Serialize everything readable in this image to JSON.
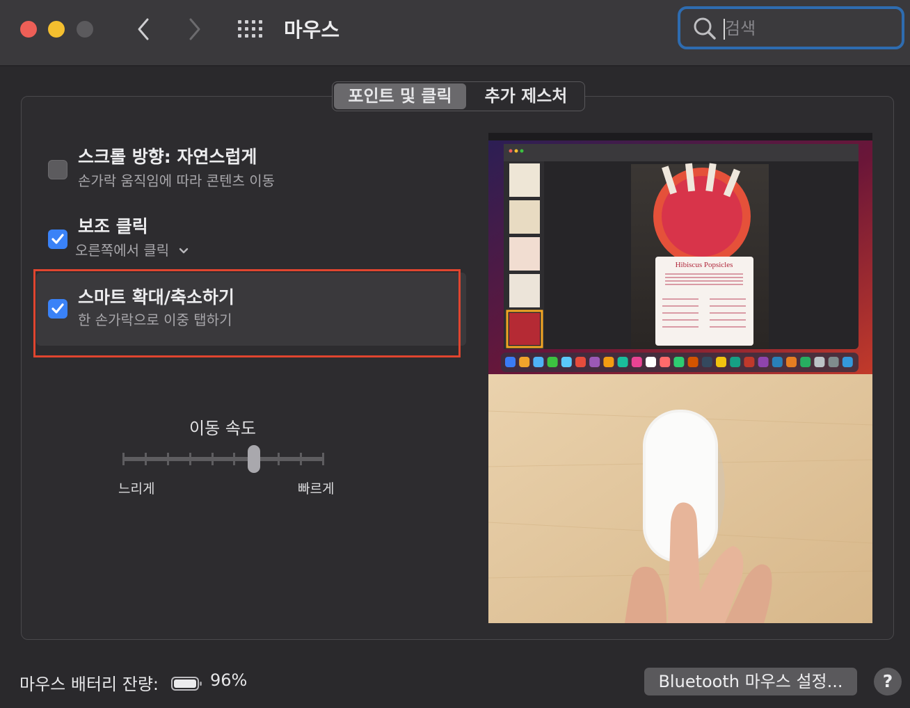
{
  "window": {
    "title": "마우스",
    "search_placeholder": "검색"
  },
  "tabs": [
    {
      "label": "포인트 및 클릭",
      "selected": true
    },
    {
      "label": "추가 제스처",
      "selected": false
    }
  ],
  "options": [
    {
      "title": "스크롤 방향: 자연스럽게",
      "subtitle": "손가락 움직임에 따라 콘텐츠 이동",
      "checked": false
    },
    {
      "title": "보조 클릭",
      "subtitle": "오른쪽에서 클릭",
      "checked": true,
      "has_dropdown": true
    },
    {
      "title": "스마트 확대/축소하기",
      "subtitle": "한 손가락으로 이중 탭하기",
      "checked": true,
      "highlighted": true
    }
  ],
  "tracking_speed": {
    "label": "이동 속도",
    "min_label": "느리게",
    "max_label": "빠르게",
    "level": 0.65,
    "tick_count": 10
  },
  "preview": {
    "doc_heading": "Hibiscus Popsicles"
  },
  "footer": {
    "battery_label": "마우스 배터리 잔량:",
    "battery_percent": "96%",
    "bluetooth_button": "Bluetooth 마우스 설정...",
    "help": "?"
  },
  "colors": {
    "accent": "#3a82f7",
    "search_focus": "#2e6cb0",
    "highlight_box": "#e0452f",
    "close": "#ed5f57",
    "minimize": "#f4bf2f"
  }
}
